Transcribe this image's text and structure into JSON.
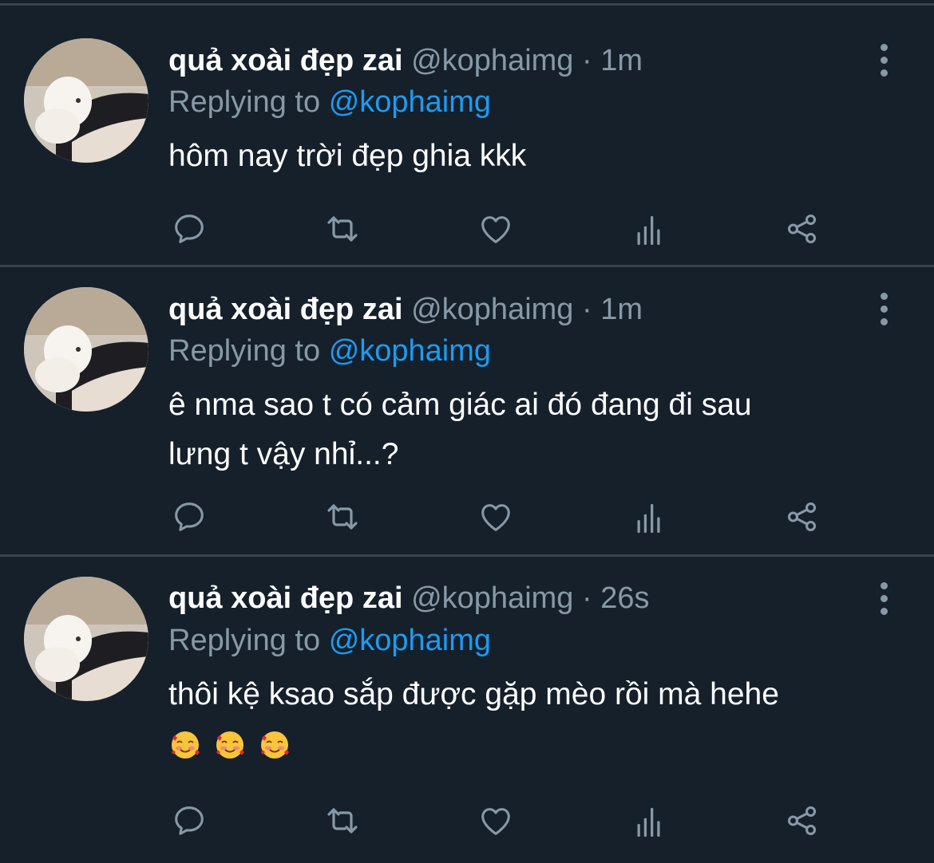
{
  "tweets": [
    {
      "name": "quả xoài đẹp zai",
      "handle": "@kophaimg",
      "separator": "·",
      "time": "1m",
      "replying_prefix": "Replying to",
      "replying_to": "@kophaimg",
      "text_lines": [
        "hôm nay trời đẹp ghia kkk"
      ],
      "emojis": []
    },
    {
      "name": "quả xoài đẹp zai",
      "handle": "@kophaimg",
      "separator": "·",
      "time": "1m",
      "replying_prefix": "Replying to",
      "replying_to": "@kophaimg",
      "text_lines": [
        "ê nma sao t có cảm giác ai đó đang đi sau",
        "lưng t vậy nhỉ...?"
      ],
      "emojis": []
    },
    {
      "name": "quả xoài đẹp zai",
      "handle": "@kophaimg",
      "separator": "·",
      "time": "26s",
      "replying_prefix": "Replying to",
      "replying_to": "@kophaimg",
      "text_lines": [
        "thôi kệ ksao sắp được gặp mèo rồi mà hehe"
      ],
      "emojis": [
        "smiling-face-with-hearts",
        "smiling-face-with-hearts",
        "smiling-face-with-hearts"
      ]
    }
  ],
  "actions": [
    "reply-icon",
    "retweet-icon",
    "like-icon",
    "analytics-icon",
    "share-icon"
  ],
  "colors": {
    "background": "#15202b",
    "divider": "#38444d",
    "secondary_text": "#8899a6",
    "mention": "#1d9bf0",
    "primary_text": "#ffffff"
  }
}
